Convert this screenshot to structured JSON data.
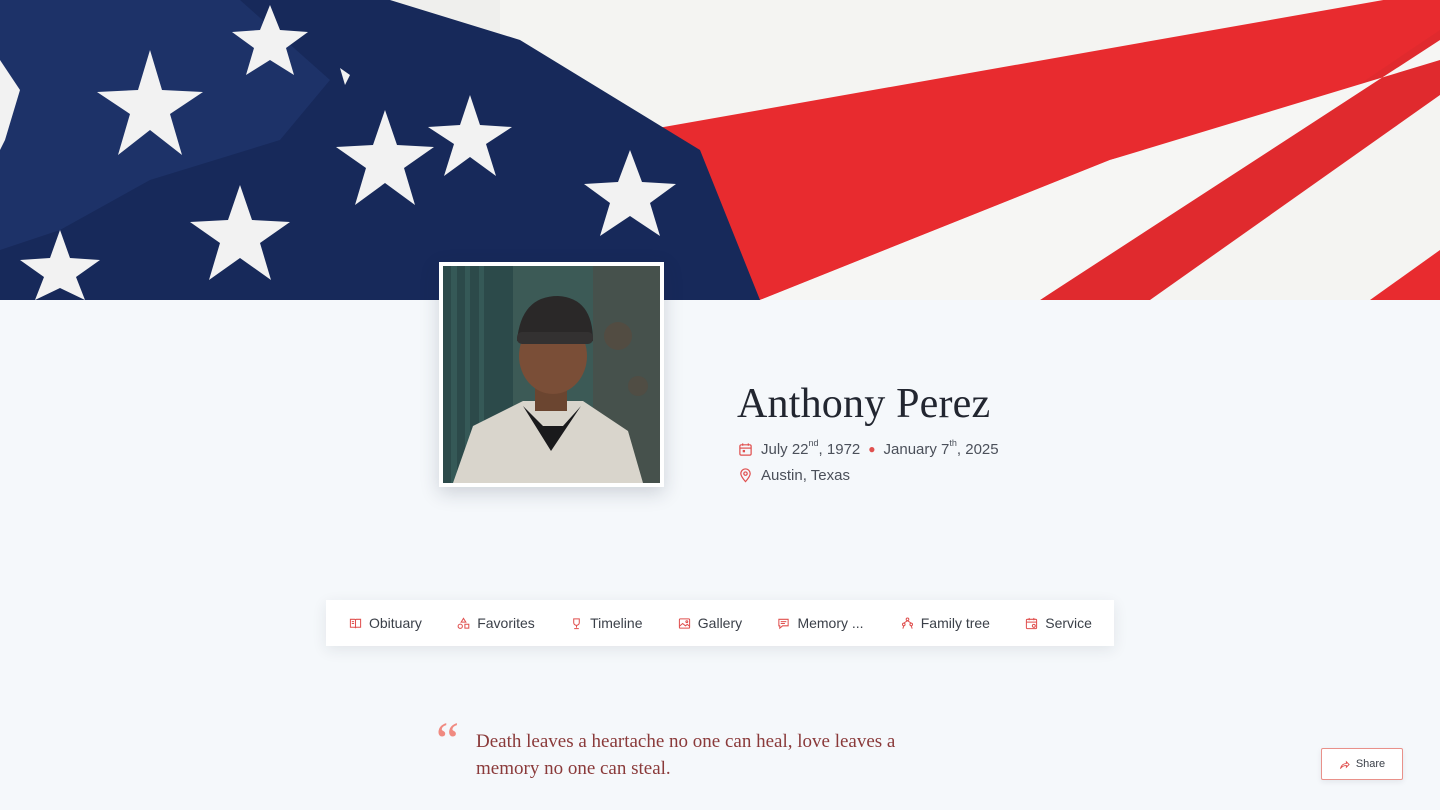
{
  "banner": {
    "image": "american-flag-photo",
    "colors": {
      "navy": "#152a5c",
      "red": "#e82b2f",
      "white": "#f4f4f2"
    }
  },
  "portrait": {
    "image": "portrait-photo-man-in-beanie"
  },
  "profile": {
    "name": "Anthony Perez",
    "birth_date_main": "July 22",
    "birth_date_suffix": "nd",
    "birth_year": ", 1972",
    "death_date_main": "January 7",
    "death_date_suffix": "th",
    "death_year": ", 2025",
    "location": "Austin, Texas"
  },
  "nav": {
    "items": [
      {
        "label": "Obituary",
        "icon": "book-icon"
      },
      {
        "label": "Favorites",
        "icon": "shapes-icon"
      },
      {
        "label": "Timeline",
        "icon": "trophy-icon"
      },
      {
        "label": "Gallery",
        "icon": "image-icon"
      },
      {
        "label": "Memory ...",
        "icon": "chat-icon"
      },
      {
        "label": "Family tree",
        "icon": "tree-icon"
      },
      {
        "label": "Service",
        "icon": "calendar-icon"
      }
    ]
  },
  "quote": {
    "mark": "“",
    "text": "Death leaves a heartache no one can heal, love leaves a memory no one can steal."
  },
  "share": {
    "label": "Share",
    "icon": "share-icon"
  },
  "accent_color": "#e0504f"
}
